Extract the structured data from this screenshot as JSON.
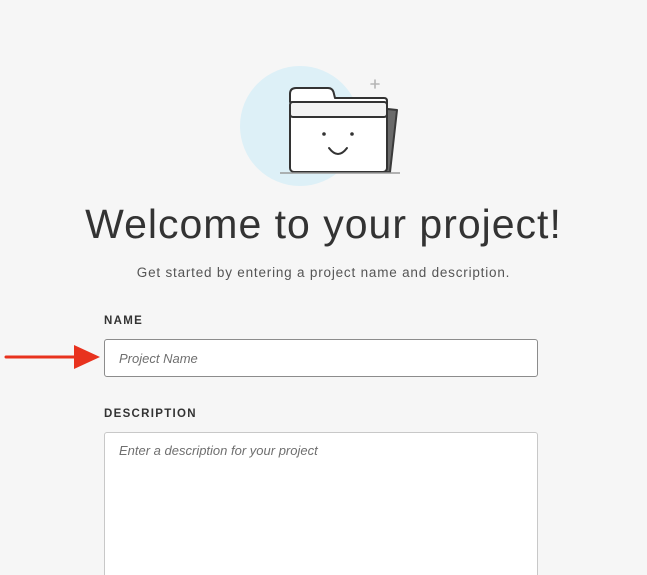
{
  "welcome": {
    "title": "Welcome to your project!",
    "subtitle": "Get started by entering a project name and description."
  },
  "form": {
    "name": {
      "label": "NAME",
      "value": "",
      "placeholder": "Project Name"
    },
    "description": {
      "label": "DESCRIPTION",
      "value": "",
      "placeholder": "Enter a description for your project"
    }
  },
  "illustration": {
    "icon": "smiling-folder-icon",
    "circle_color": "#ddf0f7"
  },
  "annotation": {
    "icon": "red-arrow-icon",
    "color": "#e8321e"
  }
}
